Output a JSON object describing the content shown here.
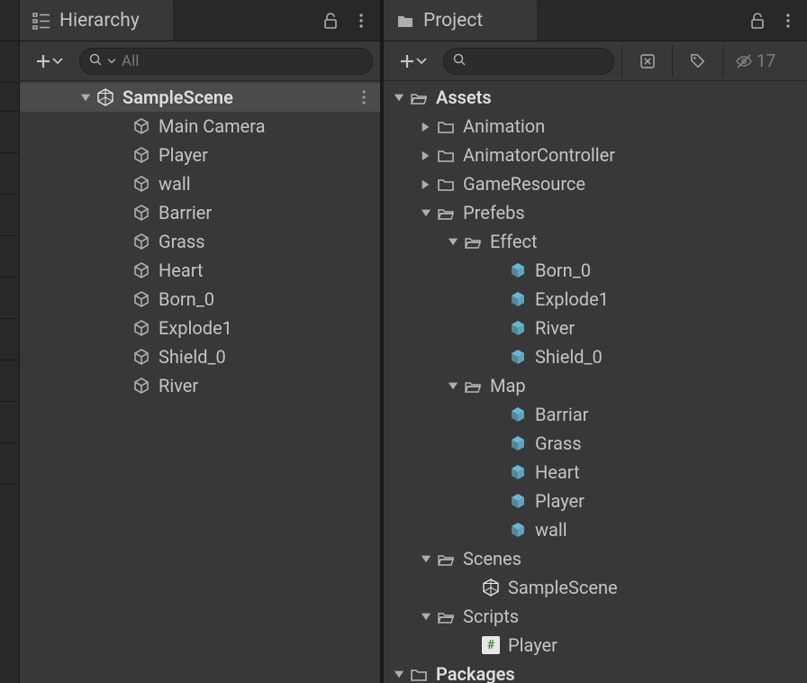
{
  "hierarchy": {
    "tab_label": "Hierarchy",
    "search_placeholder": "All",
    "scene_name": "SampleScene",
    "items": [
      {
        "label": "Main Camera"
      },
      {
        "label": "Player"
      },
      {
        "label": "wall"
      },
      {
        "label": "Barrier"
      },
      {
        "label": "Grass"
      },
      {
        "label": "Heart"
      },
      {
        "label": "Born_0"
      },
      {
        "label": "Explode1"
      },
      {
        "label": "Shield_0"
      },
      {
        "label": "River"
      }
    ]
  },
  "project": {
    "tab_label": "Project",
    "search_placeholder": "",
    "hidden_count": "17",
    "root": "Assets",
    "folders": {
      "animation": "Animation",
      "animator": "AnimatorController",
      "gameresource": "GameResource",
      "prefebs": "Prefebs",
      "effect": "Effect",
      "map": "Map",
      "scenes": "Scenes",
      "scripts": "Scripts",
      "packages": "Packages"
    },
    "effect_items": [
      {
        "label": "Born_0"
      },
      {
        "label": "Explode1"
      },
      {
        "label": "River"
      },
      {
        "label": "Shield_0"
      }
    ],
    "map_items": [
      {
        "label": "Barriar"
      },
      {
        "label": "Grass"
      },
      {
        "label": "Heart"
      },
      {
        "label": "Player"
      },
      {
        "label": "wall"
      }
    ],
    "scene_item": "SampleScene",
    "script_item": "Player"
  }
}
